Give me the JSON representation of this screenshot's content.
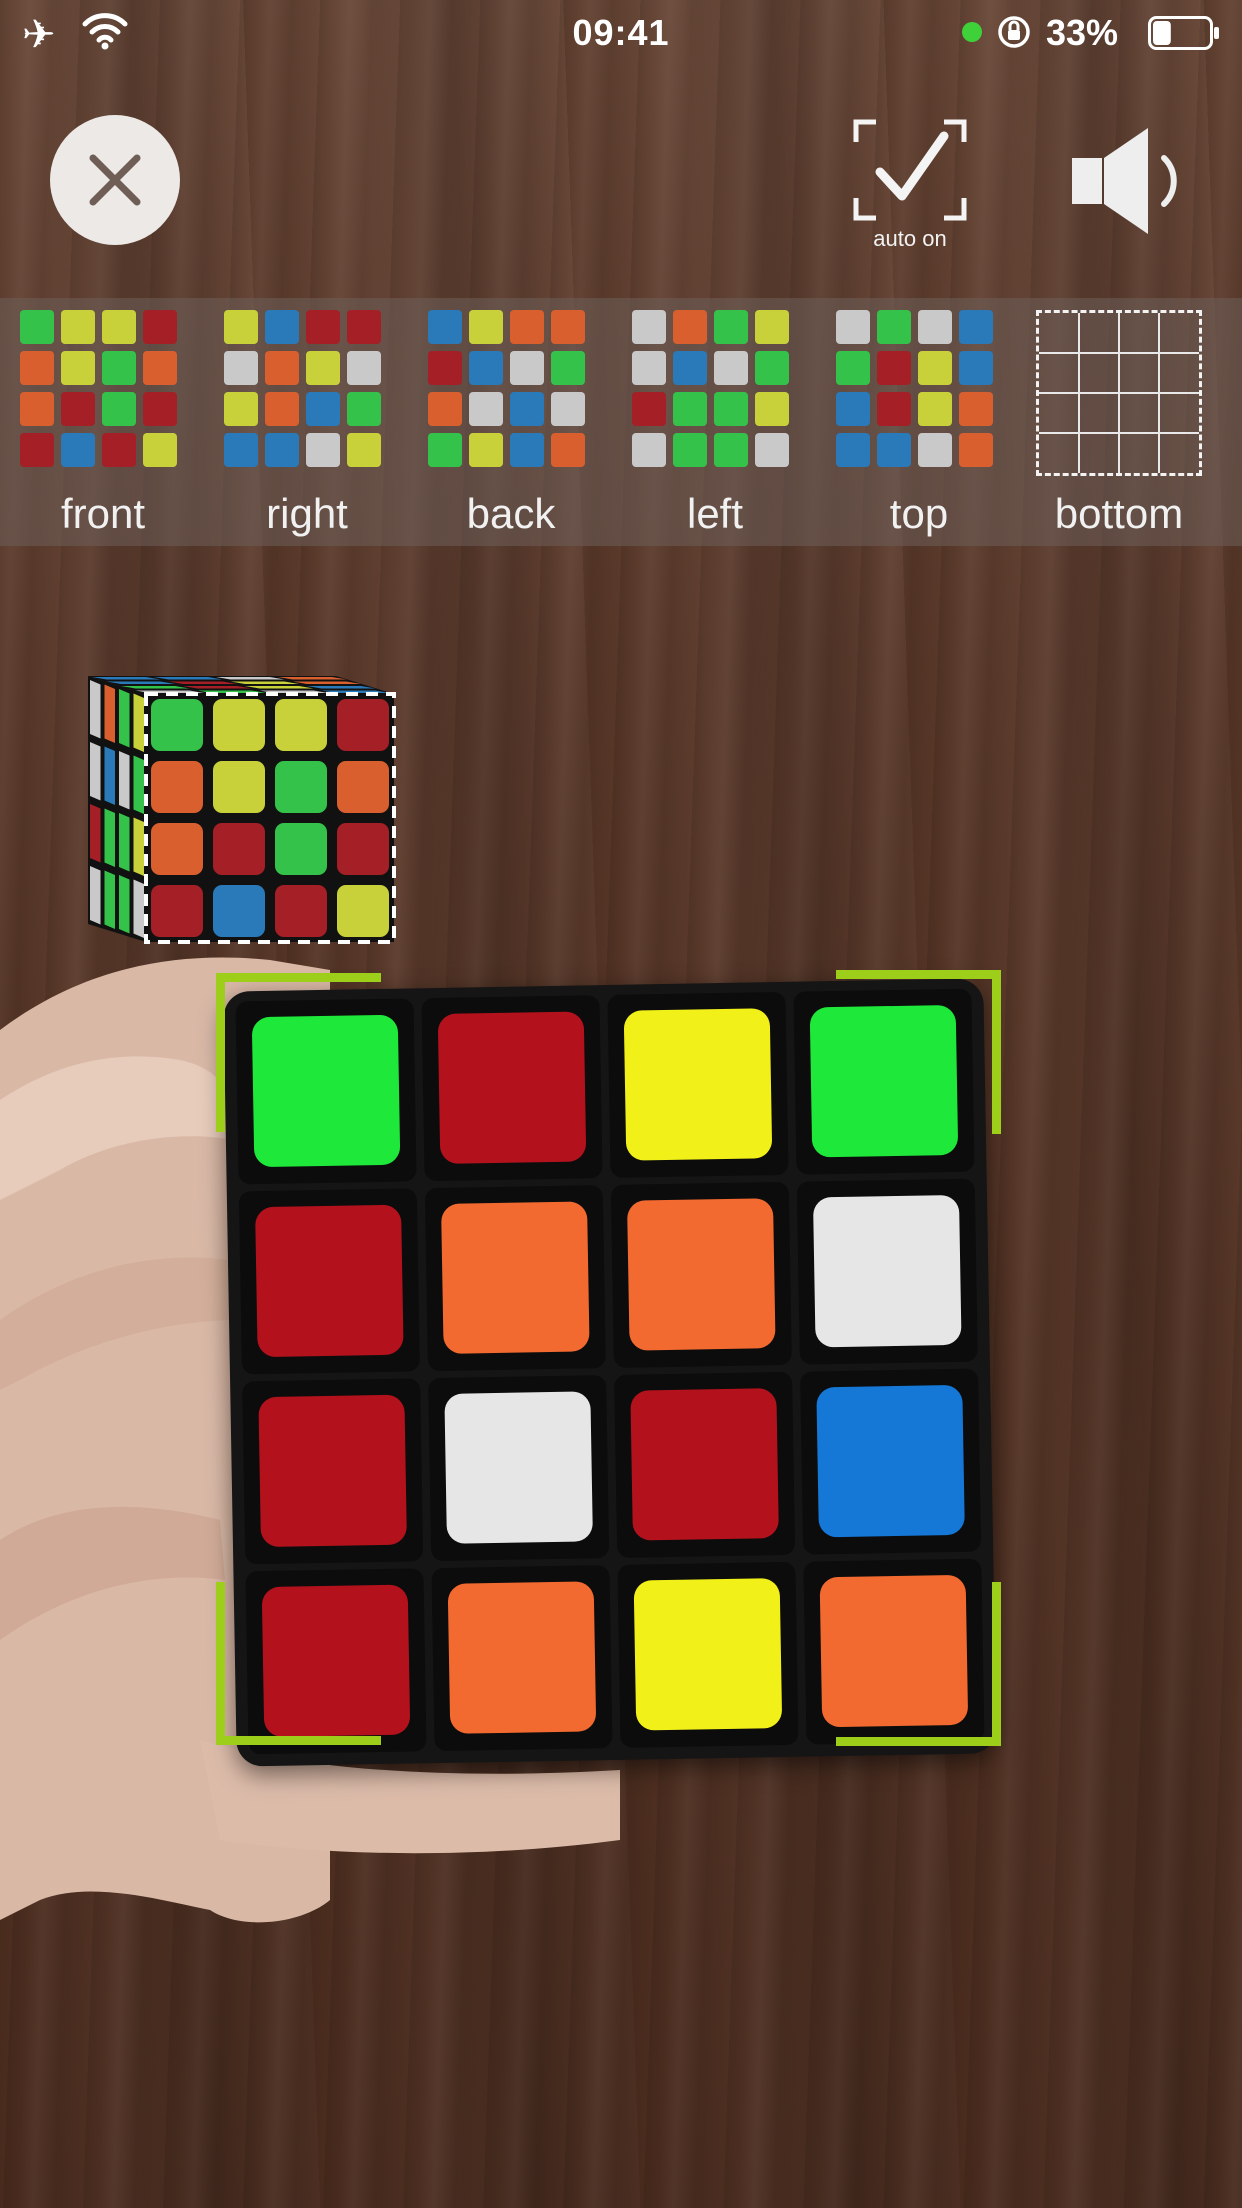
{
  "status_bar": {
    "time": "09:41",
    "battery_percent": "33%",
    "battery_level": 0.33,
    "icons": [
      "airplane-icon",
      "wifi-icon",
      "location-dot-icon",
      "rotation-lock-icon",
      "battery-icon"
    ]
  },
  "controls": {
    "close_icon": "close-icon",
    "auto_label": "auto on",
    "auto_icon": "auto-capture-check-icon",
    "sound_icon": "speaker-icon"
  },
  "colors": {
    "green": "#35c24a",
    "red": "#a51f26",
    "yellow": "#c9d13a",
    "orange": "#d9602e",
    "white": "#c9c9c9",
    "blue": "#2a79b8",
    "bracket": "#9cce1a"
  },
  "faces": [
    {
      "label": "front",
      "scanned": true,
      "grid": [
        [
          "green",
          "yellow",
          "yellow",
          "red"
        ],
        [
          "orange",
          "yellow",
          "green",
          "orange"
        ],
        [
          "orange",
          "red",
          "green",
          "red"
        ],
        [
          "red",
          "blue",
          "red",
          "yellow"
        ]
      ]
    },
    {
      "label": "right",
      "scanned": true,
      "grid": [
        [
          "yellow",
          "blue",
          "red",
          "red"
        ],
        [
          "white",
          "orange",
          "yellow",
          "white"
        ],
        [
          "yellow",
          "orange",
          "blue",
          "green"
        ],
        [
          "blue",
          "blue",
          "white",
          "yellow"
        ]
      ]
    },
    {
      "label": "back",
      "scanned": true,
      "grid": [
        [
          "blue",
          "yellow",
          "orange",
          "orange"
        ],
        [
          "red",
          "blue",
          "white",
          "green"
        ],
        [
          "orange",
          "white",
          "blue",
          "white"
        ],
        [
          "green",
          "yellow",
          "blue",
          "orange"
        ]
      ]
    },
    {
      "label": "left",
      "scanned": true,
      "grid": [
        [
          "white",
          "orange",
          "green",
          "yellow"
        ],
        [
          "white",
          "blue",
          "white",
          "green"
        ],
        [
          "red",
          "green",
          "green",
          "yellow"
        ],
        [
          "white",
          "green",
          "green",
          "white"
        ]
      ]
    },
    {
      "label": "top",
      "scanned": true,
      "grid": [
        [
          "white",
          "green",
          "white",
          "blue"
        ],
        [
          "green",
          "red",
          "yellow",
          "blue"
        ],
        [
          "blue",
          "red",
          "yellow",
          "orange"
        ],
        [
          "blue",
          "blue",
          "white",
          "orange"
        ]
      ]
    },
    {
      "label": "bottom",
      "scanned": false,
      "grid": []
    }
  ],
  "camera_face": {
    "grid": [
      [
        "green",
        "red",
        "yellow",
        "green"
      ],
      [
        "red",
        "orange",
        "orange",
        "white"
      ],
      [
        "red",
        "white",
        "red",
        "blue"
      ],
      [
        "red",
        "orange",
        "yellow",
        "orange"
      ]
    ],
    "colors": {
      "green": "#1ee83a",
      "red": "#b3121d",
      "yellow": "#f2f019",
      "orange": "#f26a30",
      "white": "#e6e6e6",
      "blue": "#1577d6"
    }
  }
}
